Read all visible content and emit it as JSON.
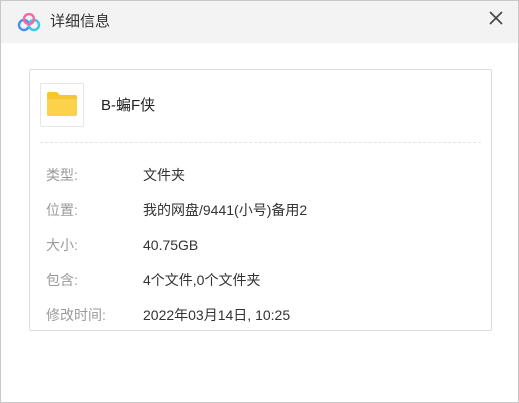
{
  "window": {
    "title": "详细信息",
    "app_icon": "baidu-netdisk-cloud-icon",
    "close_icon": "close-icon"
  },
  "file": {
    "icon": "folder-icon",
    "name": "B-蝙F侠"
  },
  "details": [
    {
      "label": "类型:",
      "value": "文件夹"
    },
    {
      "label": "位置:",
      "value": "我的网盘/9441(小号)备用2"
    },
    {
      "label": "大小:",
      "value": "40.75GB"
    },
    {
      "label": "包含:",
      "value": "4个文件,0个文件夹"
    },
    {
      "label": "修改时间:",
      "value": "2022年03月14日, 10:25"
    }
  ],
  "colors": {
    "folder": "#f7c531",
    "logo_blue": "#4a8ef0",
    "logo_cyan": "#3bc8e8",
    "logo_pink": "#f36aa0"
  }
}
